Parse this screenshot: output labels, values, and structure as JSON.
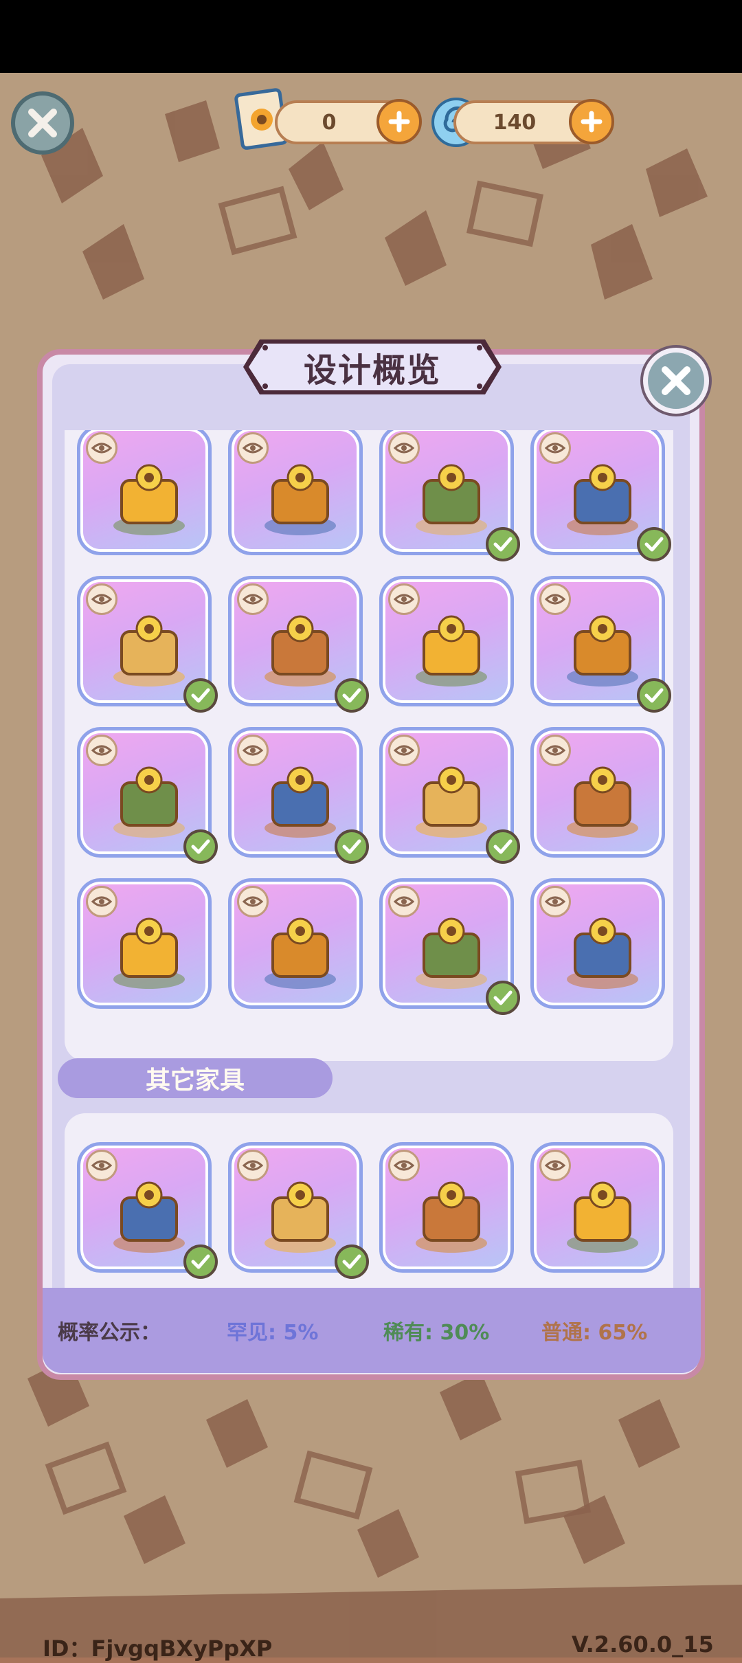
{
  "currencies": [
    {
      "icon": "sunflower-ticket-icon",
      "value": "0"
    },
    {
      "icon": "blue-swirl-icon",
      "value": "140"
    }
  ],
  "modal": {
    "title": "设计概览",
    "section_other": "其它家具"
  },
  "items_main": [
    {
      "name": "sunflower-planter",
      "owned": false
    },
    {
      "name": "easel-rug",
      "owned": false
    },
    {
      "name": "fruit-table-candle",
      "owned": true
    },
    {
      "name": "iris-vase",
      "owned": true
    },
    {
      "name": "round-lace-rug",
      "owned": true
    },
    {
      "name": "armchair",
      "owned": true
    },
    {
      "name": "sofa",
      "owned": false
    },
    {
      "name": "four-poster-bed",
      "owned": true
    },
    {
      "name": "cabinet",
      "owned": true
    },
    {
      "name": "yellow-table",
      "owned": true
    },
    {
      "name": "tall-bookcase",
      "owned": true
    },
    {
      "name": "side-table",
      "owned": false
    },
    {
      "name": "sunflower-wall-planter",
      "owned": false
    },
    {
      "name": "balcony-window",
      "owned": false
    },
    {
      "name": "narrow-window",
      "owned": true
    },
    {
      "name": "curtain-window",
      "owned": false
    }
  ],
  "items_other": [
    {
      "name": "starry-umbrella",
      "owned": true
    },
    {
      "name": "sunflower-painting",
      "owned": true
    },
    {
      "name": "signpost-lamp",
      "owned": false
    },
    {
      "name": "sunflower-chair",
      "owned": false
    }
  ],
  "probability": {
    "label": "概率公示：",
    "rare": "罕见: 5%",
    "uncommon": "稀有: 30%",
    "common": "普通: 65%"
  },
  "bottom": {
    "id": "ID：FjvgqBXyPpXP",
    "version": "V.2.60.0_15"
  },
  "colors": {
    "modal_border": "#c889a6",
    "footer": "#ab9be0",
    "rare": "#6e74d8",
    "uncommon": "#4f8b56",
    "common": "#b0734a"
  }
}
